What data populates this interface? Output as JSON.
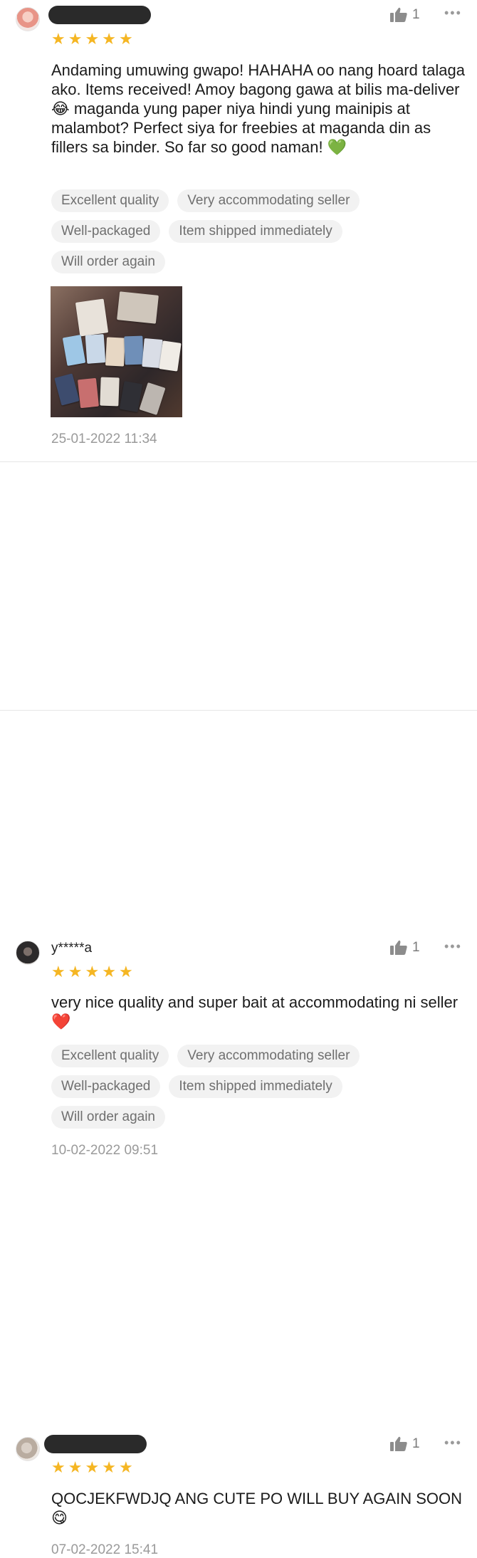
{
  "reviews": [
    {
      "username": "",
      "likes": "1",
      "more": "•••",
      "rating": 5,
      "text": "Andaming umuwing gwapo! HAHAHA oo nang hoard talaga ako. Items received! Amoy bagong gawa at bilis ma-deliver 😂 maganda yung paper niya hindi yung mainipis at malambot? Perfect siya for freebies at maganda din as fillers sa binder. So far so good naman! 💚",
      "tags": [
        "Excellent quality",
        "Very accommodating seller",
        "Well-packaged",
        "Item shipped immediately",
        "Will order again"
      ],
      "date": "25-01-2022 11:34"
    },
    {
      "username": "y*****a",
      "likes": "1",
      "more": "•••",
      "rating": 5,
      "text": "very nice quality and super bait at accommodating ni seller ❤️",
      "tags": [
        "Excellent quality",
        "Very accommodating seller",
        "Well-packaged",
        "Item shipped immediately",
        "Will order again"
      ],
      "date": "10-02-2022 09:51"
    },
    {
      "username": "",
      "likes": "1",
      "more": "•••",
      "rating": 5,
      "text": "QOCJEKFWDJQ ANG CUTE PO WILL BUY AGAIN SOON 😋",
      "tags": [],
      "date": "07-02-2022 15:41"
    }
  ],
  "icons": {
    "like": "thumbs-up-icon",
    "more": "more-options-icon",
    "star": "star-icon"
  },
  "colors": {
    "star": "#f5b623",
    "tag_bg": "#f2f2f2",
    "muted_text": "#9a9a9a"
  }
}
